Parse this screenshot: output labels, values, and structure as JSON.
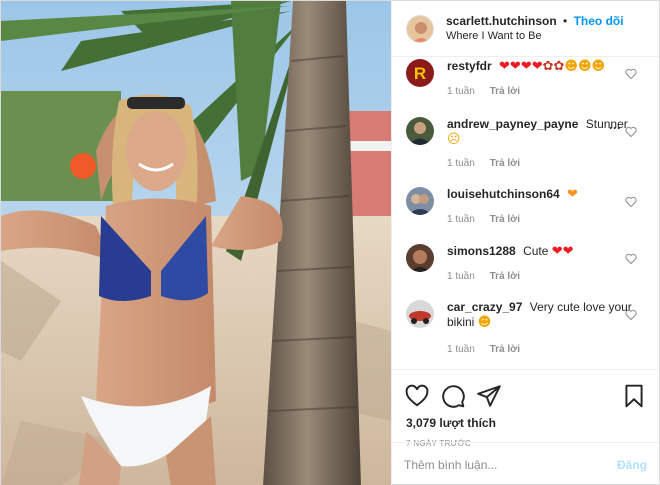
{
  "header": {
    "username": "scarlett.hutchinson",
    "separator": "•",
    "follow_label": "Theo dõi",
    "location": "Where I Want to Be"
  },
  "comments": [
    {
      "user": "restyfdr",
      "text": "",
      "emoji": [
        "heart",
        "heart",
        "heart",
        "heart",
        "rose",
        "rose",
        "heart-eyes",
        "heart-eyes",
        "heart-eyes"
      ],
      "time": "1 tuần",
      "reply": "Trả lời"
    },
    {
      "user": "andrew_payney_payne",
      "text": "Stunner",
      "emoji": [
        "surprised"
      ],
      "time": "1 tuần",
      "reply": "Trả lời"
    },
    {
      "user": "louisehutchinson64",
      "text": "",
      "emoji": [
        "orange-heart"
      ],
      "time": "1 tuần",
      "reply": "Trả lời"
    },
    {
      "user": "simons1288",
      "text": "Cute",
      "emoji": [
        "heart",
        "heart"
      ],
      "time": "1 tuần",
      "reply": "Trả lời"
    },
    {
      "user": "car_crazy_97",
      "text": "Very cute love your bikini",
      "emoji": [
        "heart-eyes"
      ],
      "time": "1 tuần",
      "reply": "Trả lời"
    }
  ],
  "actions": {
    "likes": "3,079 lượt thích",
    "date": "7 NGÀY TRƯỚC"
  },
  "add_comment": {
    "placeholder": "Thêm bình luận...",
    "post_label": "Đăng"
  },
  "colors": {
    "accent": "#0095f6",
    "post_disabled": "#b2dffc",
    "meta": "#8e8e8e",
    "heart": "#ed1c24",
    "orange_heart": "#f7931e"
  },
  "icons": [
    "like-icon",
    "comment-icon",
    "share-icon",
    "save-icon",
    "comment-like-icon"
  ]
}
